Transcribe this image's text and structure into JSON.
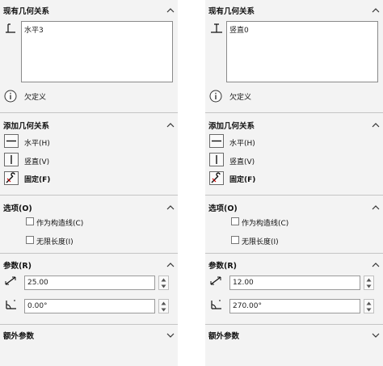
{
  "colors": {
    "panel_bg": "#f3f3f3",
    "separator": "#c4c4c4",
    "field_border": "#9a9a9a"
  },
  "icons": [
    "horizontal-relation-icon",
    "vertical-relation-icon",
    "info-icon",
    "horizontal-line-icon",
    "vertical-line-icon",
    "fixed-anchor-icon",
    "length-dimension-icon",
    "angle-dimension-icon",
    "chevron-up-icon",
    "chevron-down-icon"
  ],
  "left": {
    "existing": {
      "title": "现有几何关系",
      "relation_item": "水平3",
      "status": "欠定义"
    },
    "add": {
      "title": "添加几何关系",
      "horizontal": "水平(H)",
      "vertical": "竖直(V)",
      "fixed": "固定(F)"
    },
    "options": {
      "title": "选项(O)",
      "construction": "作为构造线(C)",
      "infinite": "无限长度(I)"
    },
    "params": {
      "title": "参数(R)",
      "length": "25.00",
      "angle": "0.00°"
    },
    "extra": {
      "title": "额外参数"
    }
  },
  "right": {
    "existing": {
      "title": "现有几何关系",
      "relation_item": "竖直0",
      "status": "欠定义"
    },
    "add": {
      "title": "添加几何关系",
      "horizontal": "水平(H)",
      "vertical": "竖直(V)",
      "fixed": "固定(F)"
    },
    "options": {
      "title": "选项(O)",
      "construction": "作为构造线(C)",
      "infinite": "无限长度(I)"
    },
    "params": {
      "title": "参数(R)",
      "length": "12.00",
      "angle": "270.00°"
    },
    "extra": {
      "title": "额外参数"
    }
  }
}
